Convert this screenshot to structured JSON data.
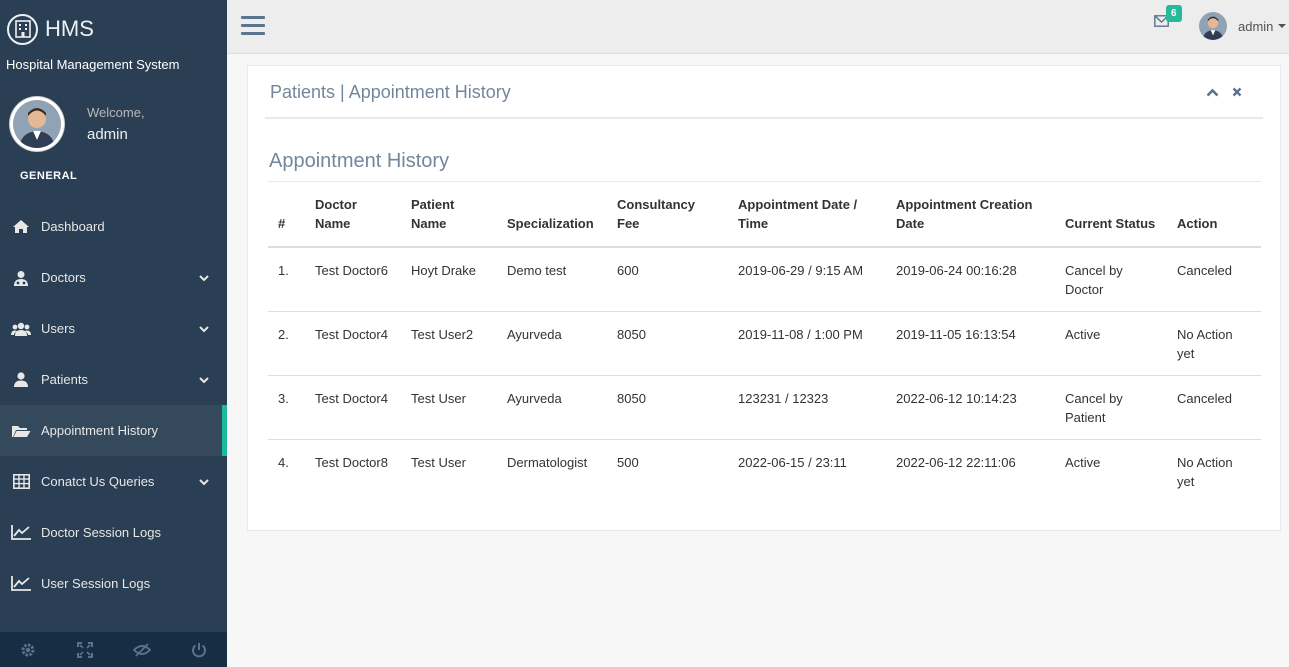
{
  "brand": {
    "title": "HMS",
    "subtitle": "Hospital Management System",
    "icon": "hospital-building-icon"
  },
  "profile": {
    "welcome": "Welcome,",
    "name": "admin"
  },
  "sidebar": {
    "section_title": "GENERAL",
    "items": [
      {
        "label": "Dashboard",
        "icon": "home-icon",
        "has_chevron": false
      },
      {
        "label": "Doctors",
        "icon": "user-md-icon",
        "has_chevron": true
      },
      {
        "label": "Users",
        "icon": "users-icon",
        "has_chevron": true
      },
      {
        "label": "Patients",
        "icon": "user-icon",
        "has_chevron": true
      },
      {
        "label": "Appointment History",
        "icon": "folder-open-icon",
        "has_chevron": false,
        "active": true
      },
      {
        "label": "Conatct Us Queries",
        "icon": "table-icon",
        "has_chevron": true
      },
      {
        "label": "Doctor Session Logs",
        "icon": "line-chart-icon",
        "has_chevron": false
      },
      {
        "label": "User Session Logs",
        "icon": "line-chart-icon",
        "has_chevron": false
      }
    ],
    "footer_icons": [
      "settings-icon",
      "fullscreen-icon",
      "lock-icon",
      "logout-icon"
    ]
  },
  "topnav": {
    "mail_badge": "6",
    "user_name": "admin"
  },
  "panel": {
    "title": "Patients | Appointment History",
    "section_heading": "Appointment History"
  },
  "table": {
    "headers": [
      "#",
      "Doctor Name",
      "Patient Name",
      "Specialization",
      "Consultancy Fee",
      "Appointment Date / Time",
      "Appointment Creation Date",
      "Current Status",
      "Action"
    ],
    "rows": [
      [
        "1.",
        "Test Doctor6",
        "Hoyt Drake",
        "Demo test",
        "600",
        "2019-06-29 / 9:15 AM",
        "2019-06-24 00:16:28",
        "Cancel by Doctor",
        "Canceled"
      ],
      [
        "2.",
        "Test Doctor4",
        "Test User2",
        "Ayurveda",
        "8050",
        "2019-11-08 / 1:00 PM",
        "2019-11-05 16:13:54",
        "Active",
        "No Action yet"
      ],
      [
        "3.",
        "Test Doctor4",
        "Test User",
        "Ayurveda",
        "8050",
        "123231 / 12323",
        "2022-06-12 10:14:23",
        "Cancel by Patient",
        "Canceled"
      ],
      [
        "4.",
        "Test Doctor8",
        "Test User",
        "Dermatologist",
        "500",
        "2022-06-15 / 23:11",
        "2022-06-12 22:11:06",
        "Active",
        "No Action yet"
      ]
    ]
  },
  "colors": {
    "sidebar_bg": "#2a3f54",
    "active_accent": "#1abb9c",
    "badge": "#26b99a"
  }
}
